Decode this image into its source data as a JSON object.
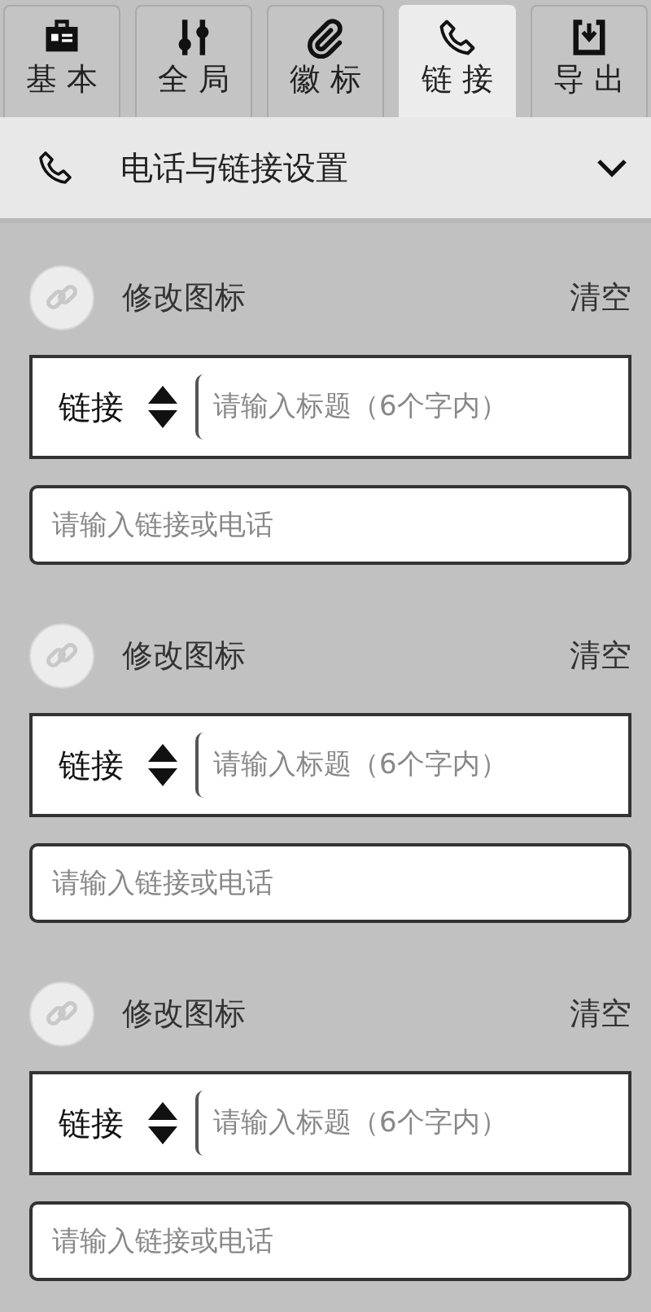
{
  "tabs": [
    {
      "label": "基 本",
      "kind": "badge",
      "selected": false
    },
    {
      "label": "全 局",
      "kind": "sliders",
      "selected": false
    },
    {
      "label": "徽 标",
      "kind": "clip",
      "selected": false
    },
    {
      "label": "链 接",
      "kind": "phone",
      "selected": true
    },
    {
      "label": "导 出",
      "kind": "export",
      "selected": false
    }
  ],
  "section": {
    "title": "电话与链接设置",
    "expanded": true
  },
  "entries": [
    {
      "change_icon": "修改图标",
      "clear": "清空",
      "type": "链接",
      "title_placeholder": "请输入标题（6个字内）",
      "url_placeholder": "请输入链接或电话"
    },
    {
      "change_icon": "修改图标",
      "clear": "清空",
      "type": "链接",
      "title_placeholder": "请输入标题（6个字内）",
      "url_placeholder": "请输入链接或电话"
    },
    {
      "change_icon": "修改图标",
      "clear": "清空",
      "type": "链接",
      "title_placeholder": "请输入标题（6个字内）",
      "url_placeholder": "请输入链接或电话"
    }
  ]
}
